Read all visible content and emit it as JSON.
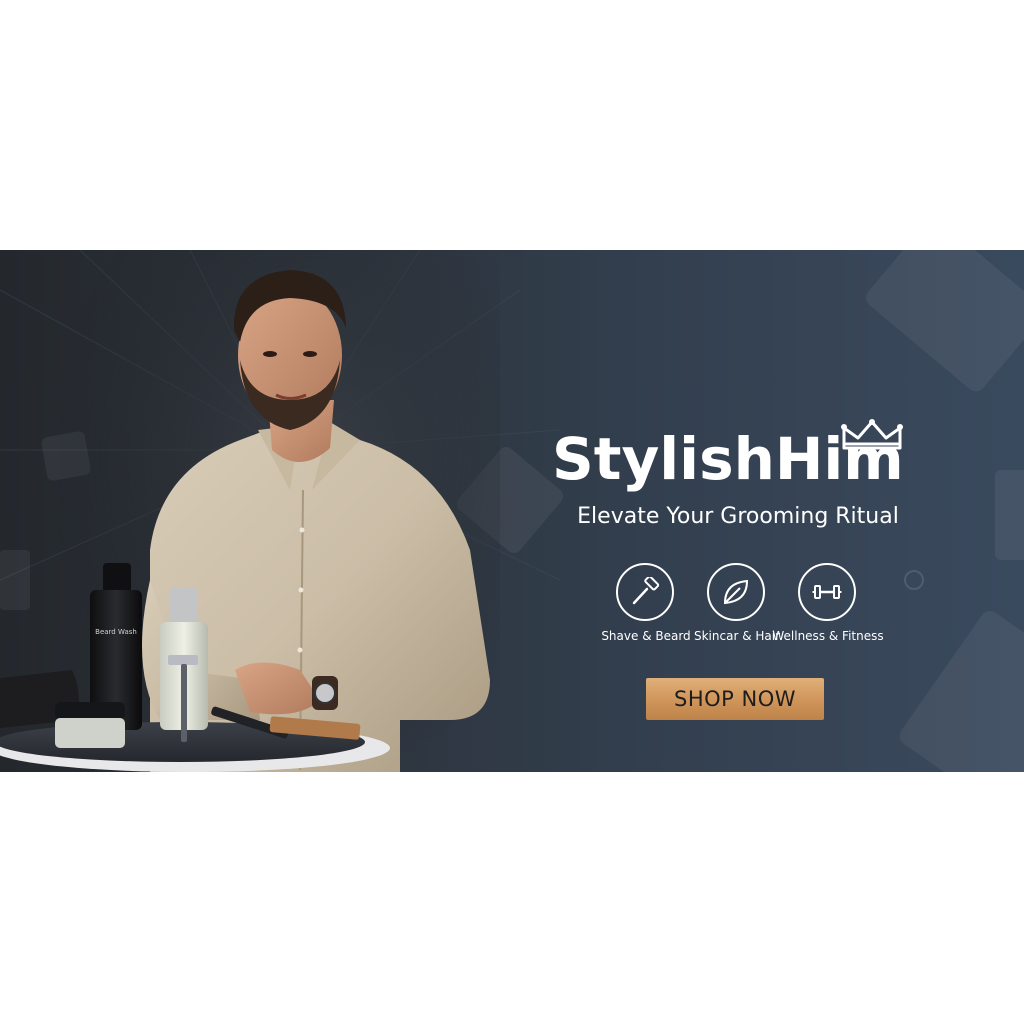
{
  "banner": {
    "brand": {
      "name": "StylishHim",
      "logo_icon": "crown-icon"
    },
    "tagline": "Elevate Your Grooming Ritual",
    "features": [
      {
        "label": "Shave & Beard",
        "icon": "razor-icon"
      },
      {
        "label": "Skincar & Hair",
        "icon": "leaf-icon"
      },
      {
        "label": "Wellness & Fitness",
        "icon": "dumbbell-icon"
      }
    ],
    "cta_label": "SHOP NOW",
    "products": {
      "bottle_label": "Beard Wash"
    }
  },
  "colors": {
    "banner_dark": "#24282d",
    "banner_blue": "#3a4a5e",
    "cta_gold": "#cf9458",
    "text": "#ffffff"
  }
}
